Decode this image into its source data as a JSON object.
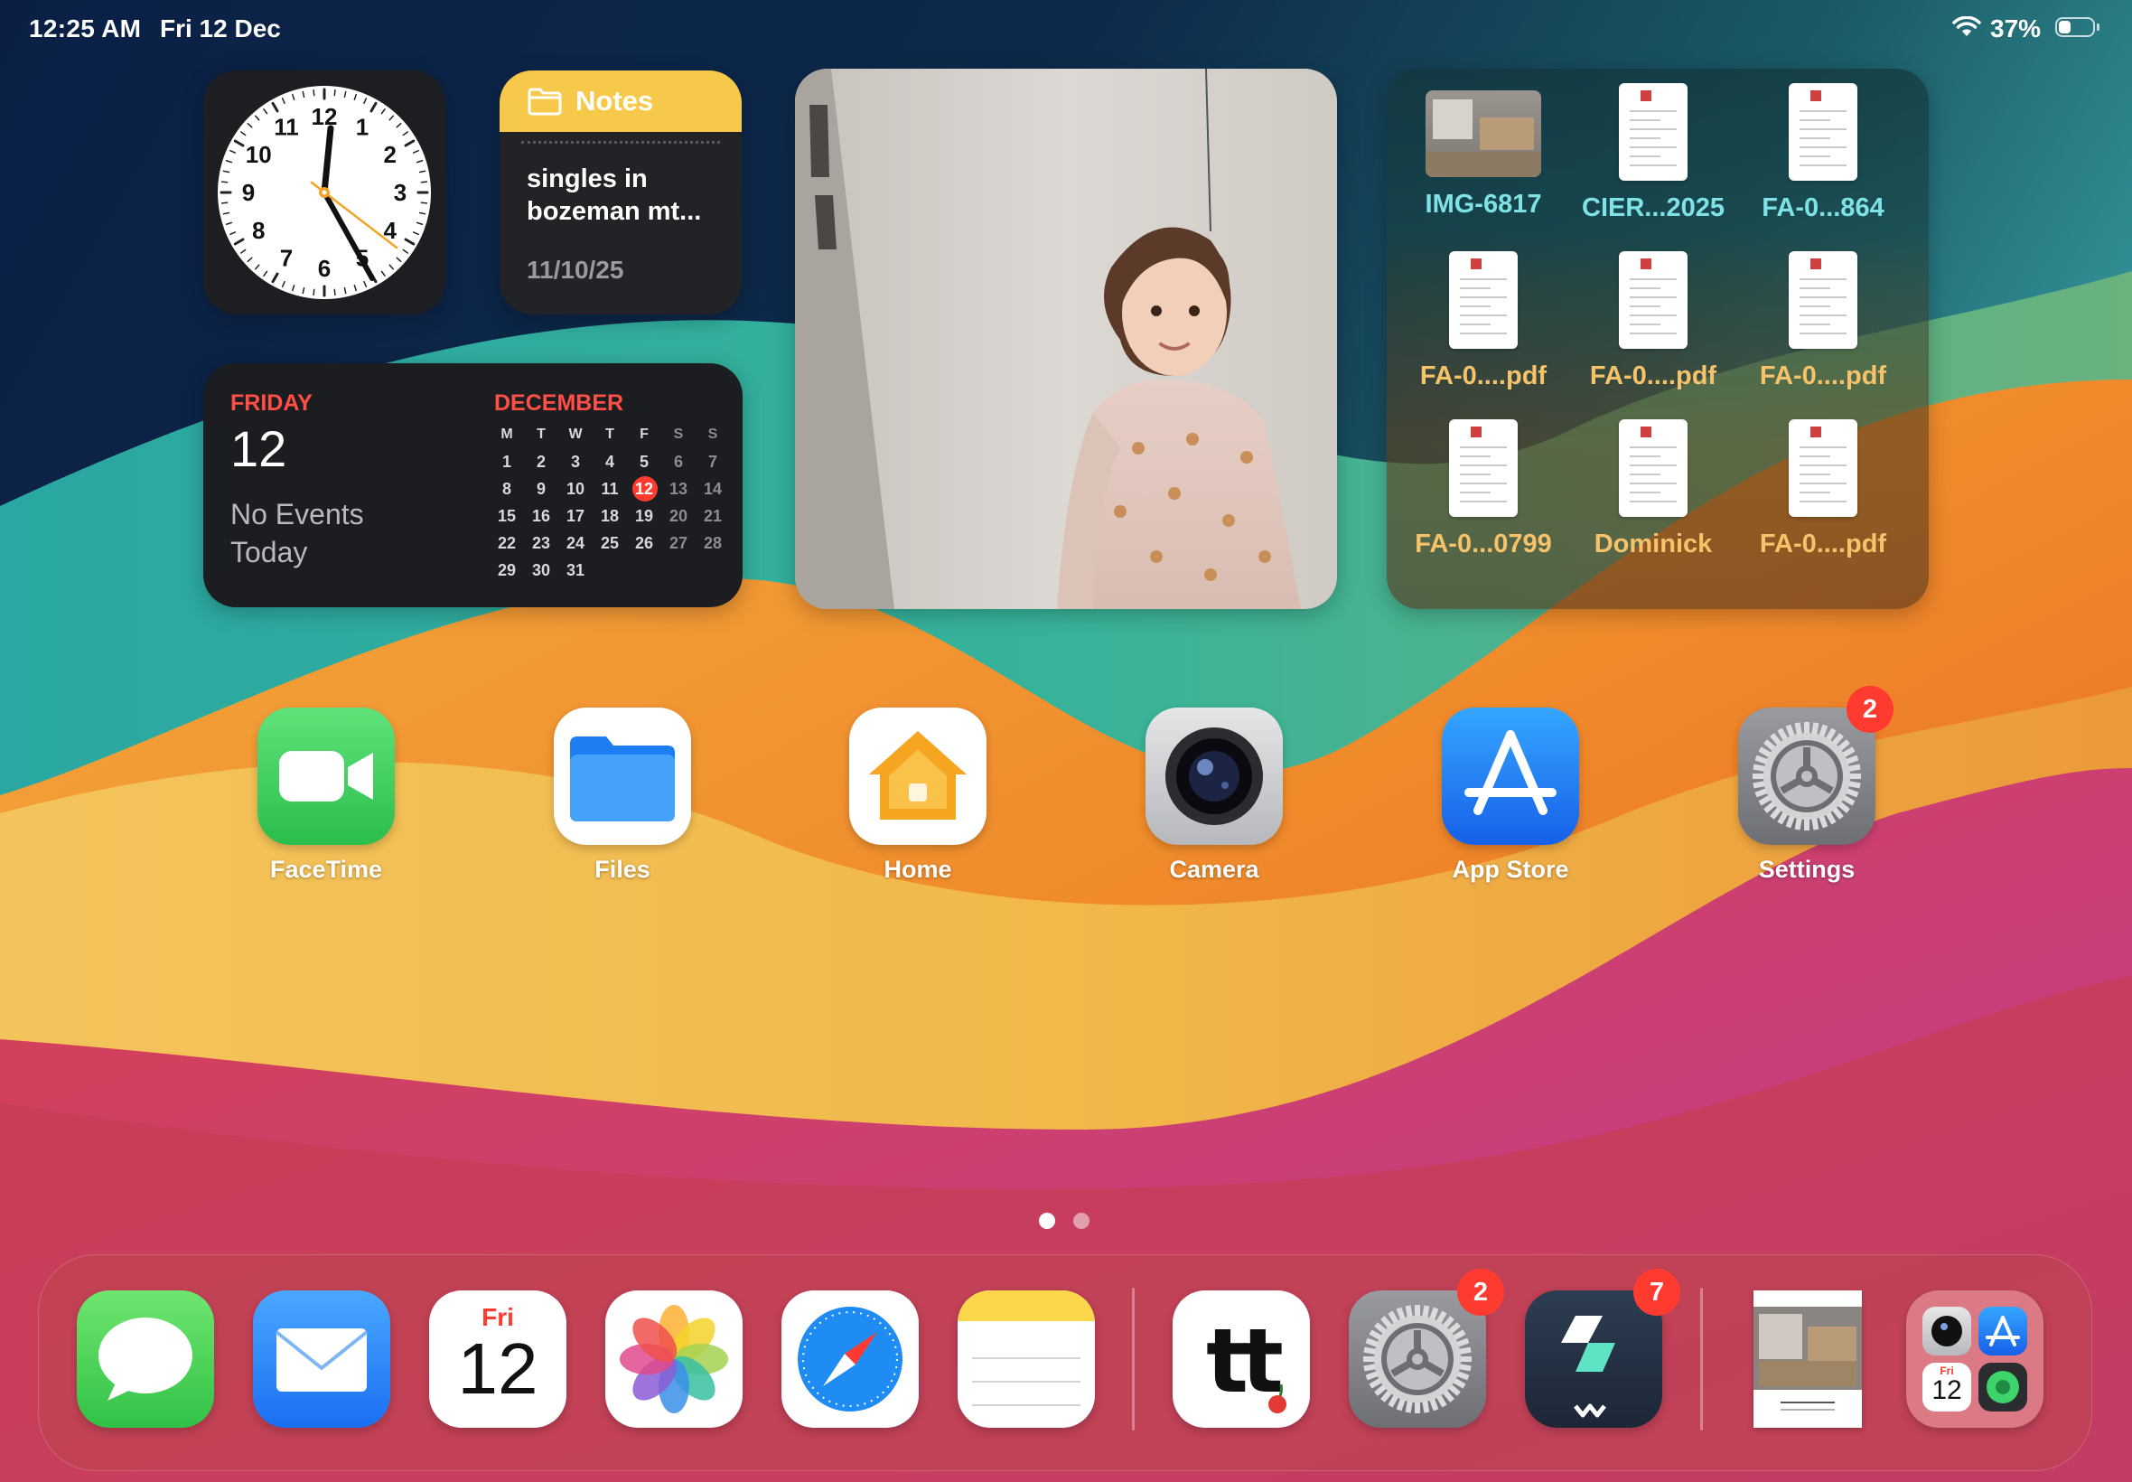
{
  "status_bar": {
    "time": "12:25 AM",
    "date": "Fri 12 Dec",
    "battery_percent": "37%",
    "battery_level": 0.37,
    "wifi_icon": "wifi-icon",
    "battery_icon": "battery-icon"
  },
  "widgets": {
    "clock": {
      "numbers": [
        "12",
        "1",
        "2",
        "3",
        "4",
        "5",
        "6",
        "7",
        "8",
        "9",
        "10",
        "11"
      ],
      "time_shown": "12:25"
    },
    "notes": {
      "title": "Notes",
      "text": "singles in bozeman mt...",
      "date": "11/10/25",
      "accent": "#f7c94a"
    },
    "calendar": {
      "weekday": "FRIDAY",
      "day": "12",
      "status_line1": "No Events",
      "status_line2": "Today",
      "month": "DECEMBER",
      "headers": [
        "M",
        "T",
        "W",
        "T",
        "F",
        "S",
        "S"
      ],
      "weeks": [
        [
          "1",
          "2",
          "3",
          "4",
          "5",
          "6",
          "7"
        ],
        [
          "8",
          "9",
          "10",
          "11",
          "12",
          "13",
          "14"
        ],
        [
          "15",
          "16",
          "17",
          "18",
          "19",
          "20",
          "21"
        ],
        [
          "22",
          "23",
          "24",
          "25",
          "26",
          "27",
          "28"
        ],
        [
          "29",
          "30",
          "31",
          "",
          "",
          "",
          ""
        ]
      ],
      "today": "12",
      "accent": "#ff4f46"
    },
    "files": [
      {
        "name": "IMG-6817",
        "kind": "photo"
      },
      {
        "name": "CIER...2025",
        "kind": "doc"
      },
      {
        "name": "FA-0...864",
        "kind": "doc"
      },
      {
        "name": "FA-0....pdf",
        "kind": "doc"
      },
      {
        "name": "FA-0....pdf",
        "kind": "doc"
      },
      {
        "name": "FA-0....pdf",
        "kind": "doc"
      },
      {
        "name": "FA-0...0799",
        "kind": "doc"
      },
      {
        "name": "Dominick",
        "kind": "doc"
      },
      {
        "name": "FA-0....pdf",
        "kind": "doc"
      }
    ]
  },
  "home_apps": [
    {
      "label": "FaceTime",
      "icon": "facetime-icon"
    },
    {
      "label": "Files",
      "icon": "files-folder-icon"
    },
    {
      "label": "Home",
      "icon": "home-icon"
    },
    {
      "label": "Camera",
      "icon": "camera-lens-icon"
    },
    {
      "label": "App Store",
      "icon": "app-store-icon"
    },
    {
      "label": "Settings",
      "icon": "settings-gear-icon",
      "badge": "2"
    }
  ],
  "page_dots": {
    "count": 2,
    "active": 1
  },
  "dock": {
    "apps": [
      {
        "name": "messages",
        "icon": "messages-bubble-icon"
      },
      {
        "name": "mail",
        "icon": "mail-envelope-icon"
      },
      {
        "name": "calendar",
        "icon": "calendar-icon",
        "day_label": "Fri",
        "date_label": "12"
      },
      {
        "name": "photos",
        "icon": "photos-flower-icon"
      },
      {
        "name": "safari",
        "icon": "safari-compass-icon"
      },
      {
        "name": "notes",
        "icon": "notes-icon"
      },
      {
        "name": "tt",
        "icon": "tt-app-icon",
        "text": "tt"
      },
      {
        "name": "settings",
        "icon": "settings-gear-icon",
        "badge": "2"
      },
      {
        "name": "filmora",
        "icon": "filmora-icon",
        "badge": "7"
      },
      {
        "name": "recent-document",
        "icon": "document-thumbnail-icon"
      },
      {
        "name": "app-library",
        "icon": "app-library-icon",
        "day_label": "Fri",
        "date_label": "12"
      }
    ]
  },
  "colors": {
    "badge": "#ff3b30",
    "calendar_red": "#ff4f46",
    "appstore_blue": "#1a7cf5",
    "facetime_green": "#4cd964"
  }
}
